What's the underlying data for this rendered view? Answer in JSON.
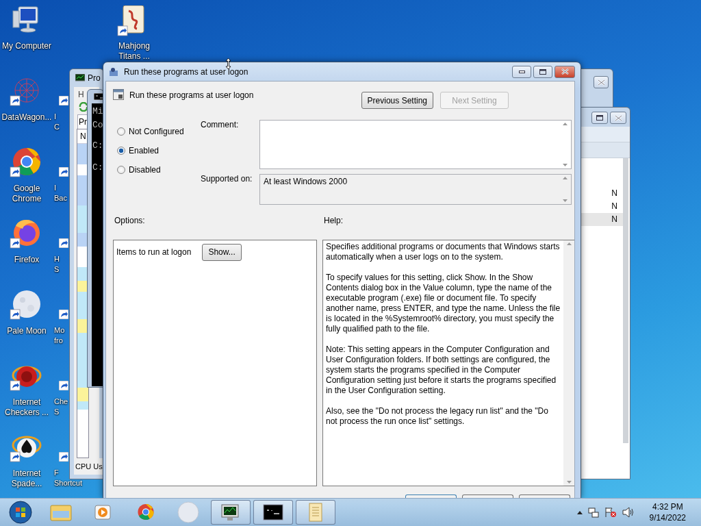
{
  "desktop": {
    "icons": [
      {
        "kind": "computer",
        "label": "My Computer",
        "shortcut": false
      },
      {
        "kind": "web",
        "label": "DataWagon...",
        "shortcut": true
      },
      {
        "kind": "chrome",
        "label": "Google Chrome",
        "shortcut": true
      },
      {
        "kind": "firefox",
        "label": "Firefox",
        "shortcut": true
      },
      {
        "kind": "moon",
        "label": "Pale Moon",
        "shortcut": true
      },
      {
        "kind": "checkers",
        "label": "Internet Checkers ...",
        "shortcut": true
      },
      {
        "kind": "spades",
        "label": "Internet Spade...",
        "shortcut": true
      }
    ],
    "partial_icons": [
      {
        "label": "I\nC"
      },
      {
        "label": "I\nBac"
      },
      {
        "label": "H\nS"
      },
      {
        "label": "Mo\nfro"
      },
      {
        "label": "Che\nS"
      },
      {
        "label": "F\nShortcut"
      }
    ],
    "extra_icon": {
      "kind": "mahjong",
      "label": "Mahjong\nTitans ...",
      "shortcut": true
    }
  },
  "task_manager": {
    "title": "Pro",
    "menu_item": "H",
    "tab": "Pr",
    "column": "N",
    "status": "CPU Us"
  },
  "console": {
    "lines": [
      "Mi",
      "Co",
      "C:",
      "C:"
    ]
  },
  "right_window": {
    "rows": [
      {
        "text": "N",
        "selected": false
      },
      {
        "text": "N",
        "selected": false
      },
      {
        "text": "N",
        "selected": true
      }
    ]
  },
  "dialog": {
    "title": "Run these programs at user logon",
    "heading": "Run these programs at user logon",
    "nav_buttons": [
      {
        "label": "Previous Setting",
        "disabled": false
      },
      {
        "label": "Next Setting",
        "disabled": true
      }
    ],
    "states": [
      {
        "label": "Not Configured",
        "selected": false
      },
      {
        "label": "Enabled",
        "selected": true
      },
      {
        "label": "Disabled",
        "selected": false
      }
    ],
    "comment_label": "Comment:",
    "supported_label": "Supported on:",
    "supported": "At least Windows 2000",
    "options_label": "Options:",
    "help_label": "Help:",
    "options": [
      {
        "label": "Items to run at logon",
        "button": "Show..."
      }
    ],
    "help": [
      "Specifies additional programs or documents that Windows starts automatically when a user logs on to the system.",
      "To specify values for this setting, click Show. In the Show Contents dialog box in the Value column, type the name of the executable program (.exe) file or document file. To specify another name, press ENTER, and type the name. Unless the file is located in the %Systemroot% directory, you must specify the fully qualified path to the file.",
      "Note: This setting appears in the Computer Configuration and User Configuration folders. If both settings are configured, the system starts the programs specified in the Computer Configuration setting just before it starts the programs specified in the User Configuration setting.",
      "Also, see the \"Do not process the legacy run list\" and the \"Do not process the run once list\" settings."
    ]
  },
  "taskbar": {
    "items": [
      {
        "kind": "explorer",
        "running": false
      },
      {
        "kind": "media",
        "running": false
      },
      {
        "kind": "chrome",
        "running": false
      },
      {
        "kind": "moon",
        "running": false
      },
      {
        "kind": "monitor",
        "running": true
      },
      {
        "kind": "console",
        "running": true
      },
      {
        "kind": "scroll",
        "running": true
      }
    ],
    "time": "4:32 PM",
    "date": "9/14/2022"
  }
}
